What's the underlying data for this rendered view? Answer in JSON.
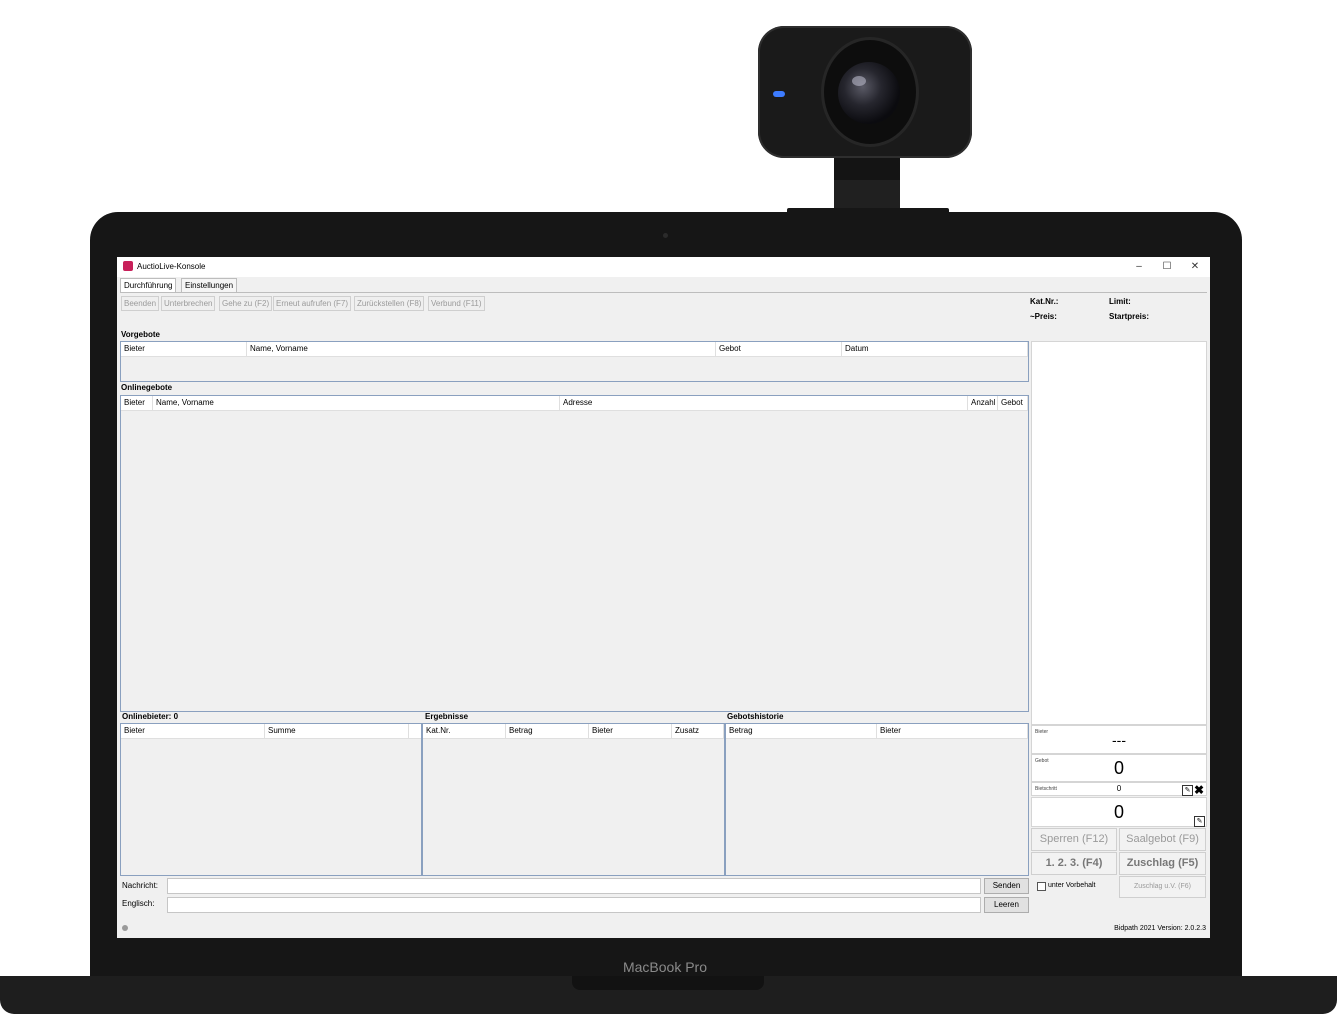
{
  "device": {
    "brand_label": "MacBook Pro"
  },
  "window": {
    "title": "AuctioLive-Konsole",
    "minimize": "–",
    "maximize": "☐",
    "close": "✕"
  },
  "tabs": [
    {
      "label": "Durchführung"
    },
    {
      "label": "Einstellungen"
    }
  ],
  "toolbar": {
    "buttons": [
      {
        "label": "Beenden"
      },
      {
        "label": "Unterbrechen"
      },
      {
        "label": "Gehe zu (F2)"
      },
      {
        "label": "Erneut aufrufen (F7)"
      },
      {
        "label": "Zurückstellen (F8)"
      },
      {
        "label": "Verbund (F11)"
      }
    ]
  },
  "vorgebote": {
    "title": "Vorgebote",
    "columns": [
      "Bieter",
      "Name, Vorname",
      "Gebot",
      "Datum"
    ]
  },
  "onlinegebote": {
    "title": "Onlinegebote",
    "columns": [
      "Bieter",
      "Name, Vorname",
      "Adresse",
      "Anzahl",
      "Gebot"
    ]
  },
  "onlinebieter": {
    "title": "Onlinebieter: 0",
    "columns": [
      "Bieter",
      "Summe"
    ]
  },
  "ergebnisse": {
    "title": "Ergebnisse",
    "columns": [
      "Kat.Nr.",
      "Betrag",
      "Bieter",
      "Zusatz"
    ]
  },
  "gebotshistorie": {
    "title": "Gebotshistorie",
    "columns": [
      "Betrag",
      "Bieter"
    ]
  },
  "lot_info": {
    "katnr_label": "Kat.Nr.:",
    "limit_label": "Limit:",
    "preis_label": "~Preis:",
    "startpreis_label": "Startpreis:"
  },
  "bidding": {
    "bieter_label": "Bieter",
    "bieter_value": "---",
    "gebot_label": "Gebot",
    "gebot_value": "0",
    "bietschritt_label": "Bietschritt",
    "bietschritt_value": "0",
    "next_value": "0"
  },
  "actions": {
    "sperren": "Sperren (F12)",
    "saalgebot": "Saalgebot (F9)",
    "count": "1. 2. 3.  (F4)",
    "zuschlag": "Zuschlag (F5)",
    "vorbehalt_label": "unter Vorbehalt",
    "zuschlag_uv": "Zuschlag u.V. (F6)"
  },
  "messages": {
    "nachricht_label": "Nachricht:",
    "englisch_label": "Englisch:",
    "senden": "Senden",
    "leeren": "Leeren",
    "nachricht_value": "",
    "englisch_value": ""
  },
  "status": {
    "text": "Bidpath 2021  Version: 2.0.2.3"
  }
}
